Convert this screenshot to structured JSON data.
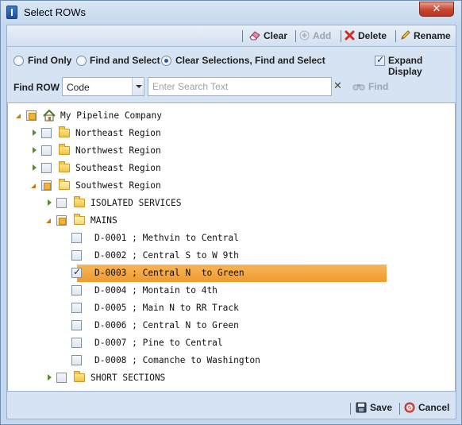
{
  "window": {
    "title": "Select ROWs",
    "close_glyph": "✕"
  },
  "toolbar": {
    "clear": {
      "label": "Clear",
      "icon": "eraser-icon",
      "enabled": true
    },
    "add": {
      "label": "Add",
      "icon": "plus-circle-icon",
      "enabled": false
    },
    "delete": {
      "label": "Delete",
      "icon": "red-x-icon",
      "enabled": true
    },
    "rename": {
      "label": "Rename",
      "icon": "pencil-icon",
      "enabled": true
    }
  },
  "options": {
    "modes": [
      {
        "label": "Find Only",
        "selected": false
      },
      {
        "label": "Find and Select",
        "selected": false
      },
      {
        "label": "Clear Selections, Find and Select",
        "selected": true
      }
    ],
    "expand_display": {
      "label": "Expand Display",
      "checked": true
    }
  },
  "find": {
    "label": "Find ROW",
    "field": "Code",
    "search_placeholder": "Enter Search Text",
    "search_value": "",
    "clear_glyph": "✕",
    "button": "Find"
  },
  "tree": [
    {
      "label": "My Pipeline Company",
      "expander": "expanded",
      "check": "partial",
      "icon": "home-icon"
    },
    {
      "label": "Northeast Region",
      "expander": "collapsed",
      "check": "none",
      "icon": "folder-icon"
    },
    {
      "label": "Northwest Region",
      "expander": "collapsed",
      "check": "none",
      "icon": "folder-icon"
    },
    {
      "label": "Southeast Region",
      "expander": "collapsed",
      "check": "none",
      "icon": "folder-icon"
    },
    {
      "label": "Southwest Region",
      "expander": "expanded",
      "check": "partial",
      "icon": "folder-open-icon"
    },
    {
      "label": "ISOLATED SERVICES",
      "expander": "collapsed",
      "check": "none",
      "icon": "folder-icon"
    },
    {
      "label": "MAINS",
      "expander": "expanded",
      "check": "partial",
      "icon": "folder-open-icon"
    },
    {
      "label": "D-0001 ; Methvin to Central",
      "check": "none"
    },
    {
      "label": "D-0002 ; Central S to W 9th",
      "check": "none"
    },
    {
      "label": "D-0003 ; Central N  to Green",
      "check": "checked",
      "selected": true
    },
    {
      "label": "D-0004 ; Montain to 4th",
      "check": "none"
    },
    {
      "label": "D-0005 ; Main N to RR Track",
      "check": "none"
    },
    {
      "label": "D-0006 ; Central N to Green",
      "check": "none"
    },
    {
      "label": "D-0007 ; Pine to Central",
      "check": "none"
    },
    {
      "label": "D-0008 ; Comanche to Washington",
      "check": "none"
    },
    {
      "label": "SHORT SECTIONS",
      "expander": "collapsed",
      "check": "none",
      "icon": "folder-icon"
    }
  ],
  "footer": {
    "save": {
      "label": "Save",
      "icon": "floppy-disk-icon"
    },
    "cancel": {
      "label": "Cancel",
      "icon": "cancel-circle-icon"
    }
  },
  "colors": {
    "selection": "#ef9a2d",
    "partial_check": "#f0b23a"
  }
}
